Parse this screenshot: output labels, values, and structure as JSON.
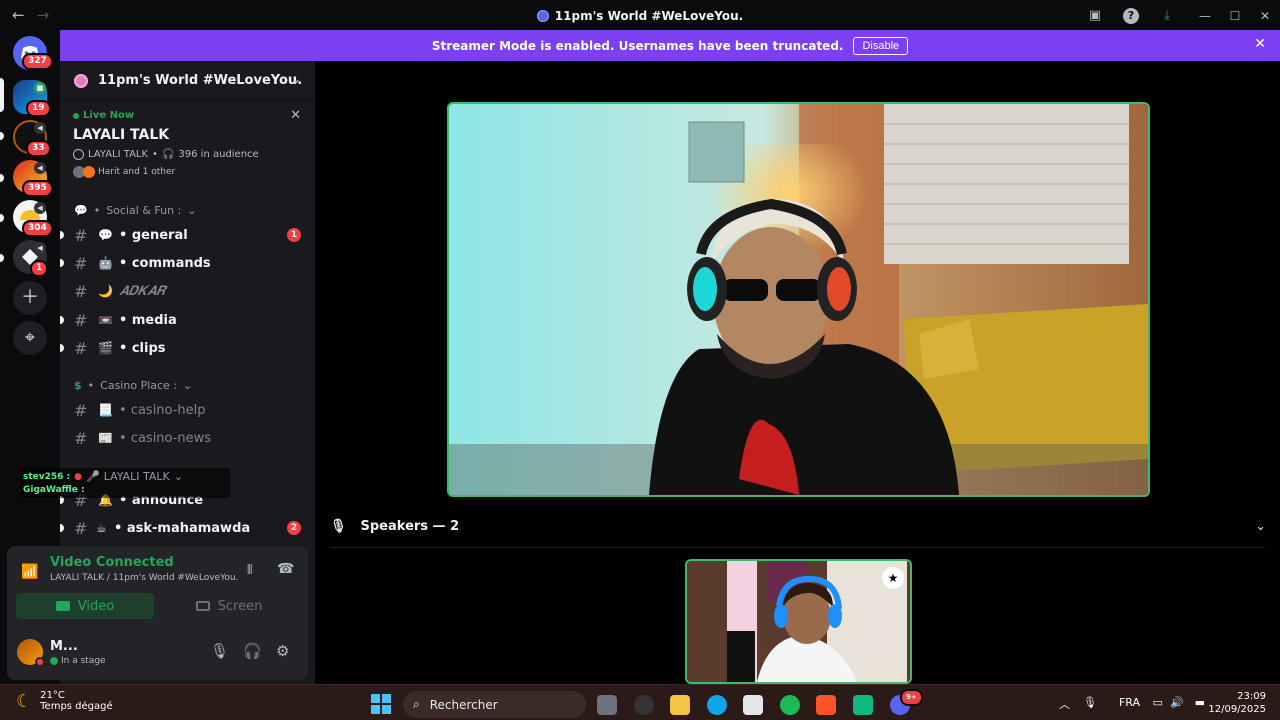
{
  "titlebar": {
    "title": "11pm's World #WeLoveYou.",
    "back_icon": "arrow-left-icon",
    "forward_icon": "arrow-right-icon"
  },
  "rail": {
    "servers": [
      {
        "name": "discord-home",
        "badge": "327"
      },
      {
        "name": "server-2",
        "badge": "19"
      },
      {
        "name": "server-3",
        "badge": "33"
      },
      {
        "name": "server-4",
        "badge": "395"
      },
      {
        "name": "server-5",
        "badge": "304"
      },
      {
        "name": "server-6",
        "badge": "1"
      }
    ]
  },
  "banner": {
    "text": "Streamer Mode is enabled. Usernames have been truncated.",
    "button": "Disable"
  },
  "server_header": {
    "name": "11pm's World #WeLoveYou."
  },
  "live": {
    "status": "Live Now",
    "stage_name": "LAYALI TALK",
    "stage_meta": "LAYALI TALK",
    "audience": "396 in audience",
    "participants": "Harit and 1 other"
  },
  "categories": {
    "social": "Social & Fun :",
    "casino": "Casino Place :",
    "layali": "LAYALI TALK"
  },
  "channels": [
    {
      "name": "general",
      "emoji": "💬",
      "badge": "1"
    },
    {
      "name": "commands",
      "emoji": "🤖"
    },
    {
      "name": "𝑨𝑫𝑲𝑨𝑹",
      "emoji": "🌙"
    },
    {
      "name": "media",
      "emoji": "📼"
    },
    {
      "name": "clips",
      "emoji": "🎬"
    },
    {
      "name": "casino-help",
      "emoji": "📃"
    },
    {
      "name": "casino-news",
      "emoji": "📰"
    },
    {
      "name": "announce",
      "emoji": "🔔"
    },
    {
      "name": "ask-mahamawda",
      "emoji": "☕",
      "badge": "2"
    }
  ],
  "overlay": {
    "user1": "stev256 :",
    "user2": "GigaWaffle :"
  },
  "voice": {
    "status": "Video Connected",
    "location": "LAYALI TALK / 11pm's World #WeLoveYou.",
    "video_label": "Video",
    "screen_label": "Screen"
  },
  "user": {
    "name": "M...",
    "status": "In a stage"
  },
  "stage": {
    "speakers_label": "Speakers — 2"
  },
  "taskbar": {
    "temperature": "21°C",
    "weather": "Temps dégagé",
    "search": "Rechercher",
    "language": "FRA",
    "time": "23:09",
    "date": "12/09/2025",
    "discord_badge": "9+"
  },
  "colors": {
    "accent_green": "#23a55a",
    "banner_purple": "#7c40f0",
    "badge_red": "#f23f43"
  }
}
